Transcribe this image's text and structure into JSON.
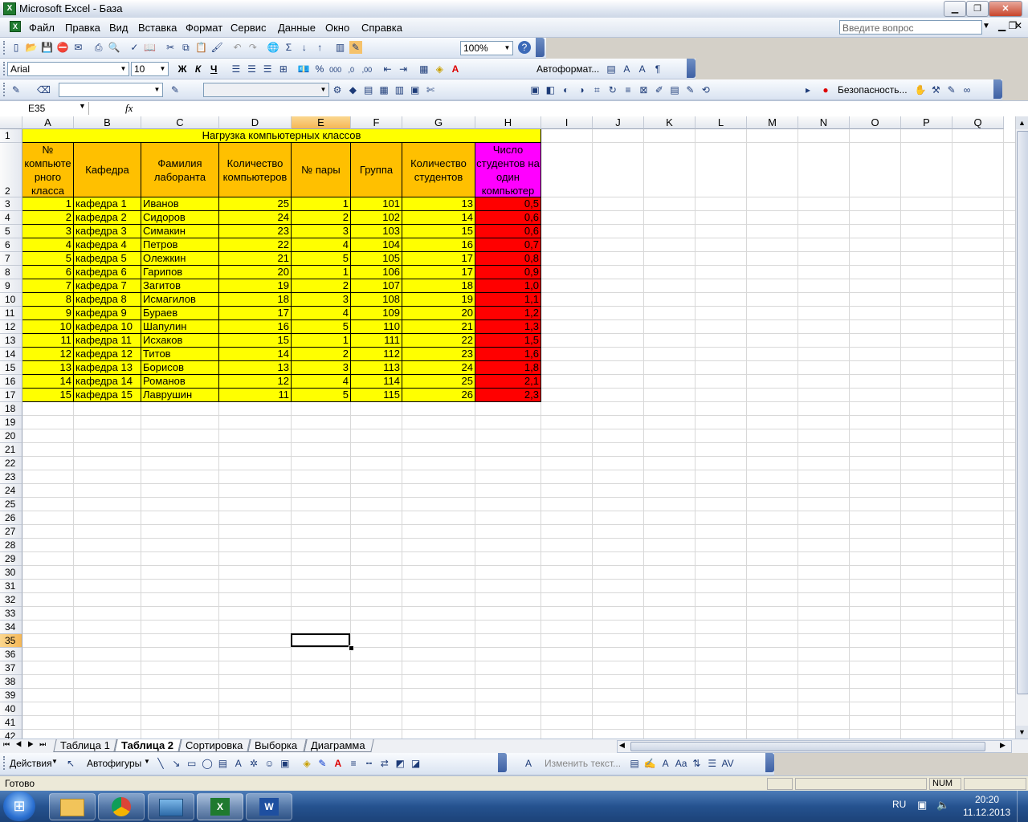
{
  "window": {
    "title": "Microsoft Excel - База",
    "app_icon": "excel-icon"
  },
  "menu": [
    "Файл",
    "Правка",
    "Вид",
    "Вставка",
    "Формат",
    "Сервис",
    "Данные",
    "Окно",
    "Справка"
  ],
  "ask_placeholder": "Введите вопрос",
  "toolbar": {
    "zoom": "100%",
    "font": "Arial",
    "size": "10",
    "bold": "Ж",
    "italic": "К",
    "underline": "Ч",
    "autoformat": "Автоформат...",
    "security": "Безопасность..."
  },
  "formula_bar": {
    "name_box": "E35",
    "fx": "fx",
    "content": ""
  },
  "columns": [
    "A",
    "B",
    "C",
    "D",
    "E",
    "F",
    "G",
    "H",
    "I",
    "J",
    "K",
    "L",
    "M",
    "N",
    "O",
    "P",
    "Q"
  ],
  "rows": [
    "1",
    "2",
    "3",
    "4",
    "5",
    "6",
    "7",
    "8",
    "9",
    "10",
    "11",
    "12",
    "13",
    "14",
    "15",
    "16",
    "17",
    "18",
    "19",
    "20",
    "21",
    "22",
    "23",
    "24",
    "25",
    "26",
    "27",
    "28",
    "29",
    "30",
    "31",
    "32",
    "33",
    "34",
    "35",
    "36",
    "37",
    "38",
    "39",
    "40",
    "41",
    "42"
  ],
  "sheet": {
    "title": "Нагрузка компьютерных классов",
    "headers": [
      "№ компьюте рного класса",
      "Кафедра",
      "Фамилия лаборанта",
      "Количество компьютеров",
      "№ пары",
      "Группа",
      "Количество студентов",
      "Число студентов на один компьютер"
    ],
    "data": [
      [
        "1",
        "кафедра 1",
        "Иванов",
        "25",
        "1",
        "101",
        "13",
        "0,5"
      ],
      [
        "2",
        "кафедра 2",
        "Сидоров",
        "24",
        "2",
        "102",
        "14",
        "0,6"
      ],
      [
        "3",
        "кафедра 3",
        "Симакин",
        "23",
        "3",
        "103",
        "15",
        "0,6"
      ],
      [
        "4",
        "кафедра 4",
        "Петров",
        "22",
        "4",
        "104",
        "16",
        "0,7"
      ],
      [
        "5",
        "кафедра 5",
        "Олежкин",
        "21",
        "5",
        "105",
        "17",
        "0,8"
      ],
      [
        "6",
        "кафедра 6",
        "Гарипов",
        "20",
        "1",
        "106",
        "17",
        "0,9"
      ],
      [
        "7",
        "кафедра 7",
        "Загитов",
        "19",
        "2",
        "107",
        "18",
        "1,0"
      ],
      [
        "8",
        "кафедра 8",
        "Исмагилов",
        "18",
        "3",
        "108",
        "19",
        "1,1"
      ],
      [
        "9",
        "кафедра 9",
        "Бураев",
        "17",
        "4",
        "109",
        "20",
        "1,2"
      ],
      [
        "10",
        "кафедра 10",
        "Шапулин",
        "16",
        "5",
        "110",
        "21",
        "1,3"
      ],
      [
        "11",
        "кафедра 11",
        "Исхаков",
        "15",
        "1",
        "111",
        "22",
        "1,5"
      ],
      [
        "12",
        "кафедра 12",
        "Титов",
        "14",
        "2",
        "112",
        "23",
        "1,6"
      ],
      [
        "13",
        "кафедра 13",
        "Борисов",
        "13",
        "3",
        "113",
        "24",
        "1,8"
      ],
      [
        "14",
        "кафедра 14",
        "Романов",
        "12",
        "4",
        "114",
        "25",
        "2,1"
      ],
      [
        "15",
        "кафедра 15",
        "Лаврушин",
        "11",
        "5",
        "115",
        "26",
        "2,3"
      ]
    ]
  },
  "tabs": [
    "Таблица 1",
    "Таблица 2",
    "Сортировка",
    "Выборка",
    "Диаграмма"
  ],
  "active_tab": "Таблица 2",
  "drawing": {
    "actions": "Действия",
    "autoshapes": "Автофигуры",
    "edit_text": "Изменить текст..."
  },
  "status": {
    "ready": "Готово",
    "num": "NUM"
  },
  "taskbar": {
    "lang": "RU",
    "time": "20:20",
    "date": "11.12.2013"
  },
  "colors": {
    "yellow": "#ffff00",
    "orange": "#ffc000",
    "magenta": "#ff00ff",
    "red": "#ff0000",
    "selected_header": "#f5b756"
  }
}
